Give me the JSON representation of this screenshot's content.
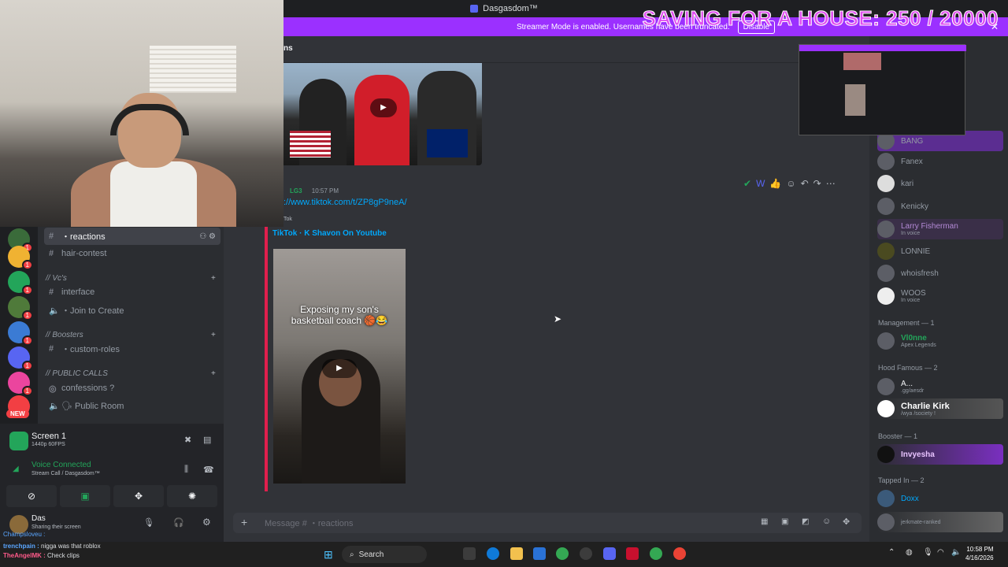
{
  "window": {
    "title": "Dasgasdom™"
  },
  "overlay": {
    "saving": "SAVING FOR A HOUSE: 250 / 20000"
  },
  "banner": {
    "text": "Streamer Mode is enabled. Usernames have been truncated.",
    "button": "Disable",
    "close": "✕"
  },
  "header": {
    "fragment": "ns"
  },
  "servers": {
    "new_badge": "NEW",
    "badge": "1"
  },
  "channels": {
    "active": "・reactions",
    "hair": "hair-contest",
    "vcs": "// Vc's",
    "interface": "interface",
    "join": "・Join to Create",
    "boosters": "// Boosters",
    "custom": "・custom-roles",
    "public": "// PUBLIC CALLS",
    "confessions": "confessions ?",
    "publicroom": "🗣 Public Room"
  },
  "stream": {
    "title": "Screen 1",
    "quality": "1440p 60FPS",
    "voice": "Voice Connected",
    "call": "Stream Call / Dasgasdom™"
  },
  "user": {
    "name": "Das",
    "status": "Sharing their screen"
  },
  "message": {
    "author": "LG3",
    "time": "10:57 PM",
    "link": "://www.tiktok.com/t/ZP8gP9neA/",
    "provider": "Tok",
    "embed_title": "TikTok · K Shavon On Youtube",
    "video_caption": "Exposing my son's basketball coach 🏀😂"
  },
  "composer": {
    "placeholder": "Message # ・reactions"
  },
  "members": {
    "top": [
      {
        "name": "BANG"
      },
      {
        "name": "Fanex"
      },
      {
        "name": "kari"
      },
      {
        "name": "Kenicky"
      },
      {
        "name": "Larry Fisherman",
        "sub": "In voice"
      },
      {
        "name": "LONNIE"
      },
      {
        "name": "whoisfresh"
      },
      {
        "name": "WOOS",
        "sub": "In voice"
      }
    ],
    "management_header": "Management — 1",
    "management": [
      {
        "name": "Vl0nne",
        "sub": "Apex Legends"
      }
    ],
    "hood_header": "Hood Famous — 2",
    "hood": [
      {
        "name": "A...",
        "sub": ".gg/aesdr"
      },
      {
        "name": "Charlie Kirk",
        "sub": "/wya /society !"
      }
    ],
    "booster_header": "Booster — 1",
    "booster": [
      {
        "name": "Invyesha"
      }
    ],
    "tapped_header": "Tapped In — 2",
    "tapped": [
      {
        "name": "Doxx"
      },
      {
        "name": "",
        "sub": "jerkmate-ranked"
      }
    ]
  },
  "chatoverlay": [
    {
      "user": "Champsloveu :",
      "msg": ""
    },
    {
      "user": "trenchpain :",
      "msg": "nigga was that roblox"
    },
    {
      "user": "TheAngelMK :",
      "msg": "Check clips"
    }
  ],
  "taskbar": {
    "search": "Search",
    "time": "10:58 PM",
    "date": "4/16/2026"
  }
}
